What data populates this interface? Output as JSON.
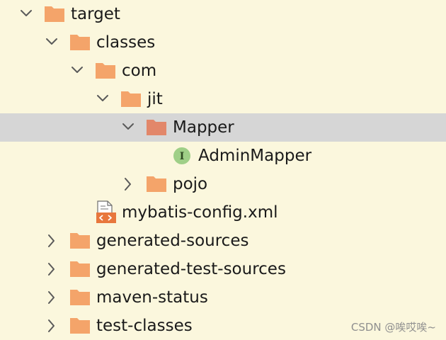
{
  "colors": {
    "background": "#fbf7dd",
    "selection": "#d6d6d6",
    "folder": "#f4a46a",
    "folder_selected": "#e2876a",
    "interface_badge": "#9fcf87"
  },
  "tree": {
    "items": [
      {
        "label": "target",
        "icon": "folder-icon",
        "expanded": true
      },
      {
        "label": "classes",
        "icon": "folder-icon",
        "expanded": true
      },
      {
        "label": "com",
        "icon": "folder-icon",
        "expanded": true
      },
      {
        "label": "jit",
        "icon": "folder-icon",
        "expanded": true
      },
      {
        "label": "Mapper",
        "icon": "folder-icon",
        "expanded": true,
        "selected": true
      },
      {
        "label": "AdminMapper",
        "icon": "interface-icon",
        "badge": "I"
      },
      {
        "label": "pojo",
        "icon": "folder-icon",
        "expanded": false
      },
      {
        "label": "mybatis-config.xml",
        "icon": "xml-file-icon"
      },
      {
        "label": "generated-sources",
        "icon": "folder-icon",
        "expanded": false
      },
      {
        "label": "generated-test-sources",
        "icon": "folder-icon",
        "expanded": false
      },
      {
        "label": "maven-status",
        "icon": "folder-icon",
        "expanded": false
      },
      {
        "label": "test-classes",
        "icon": "folder-icon",
        "expanded": false
      }
    ]
  },
  "watermark": "CSDN @唉哎唉~"
}
